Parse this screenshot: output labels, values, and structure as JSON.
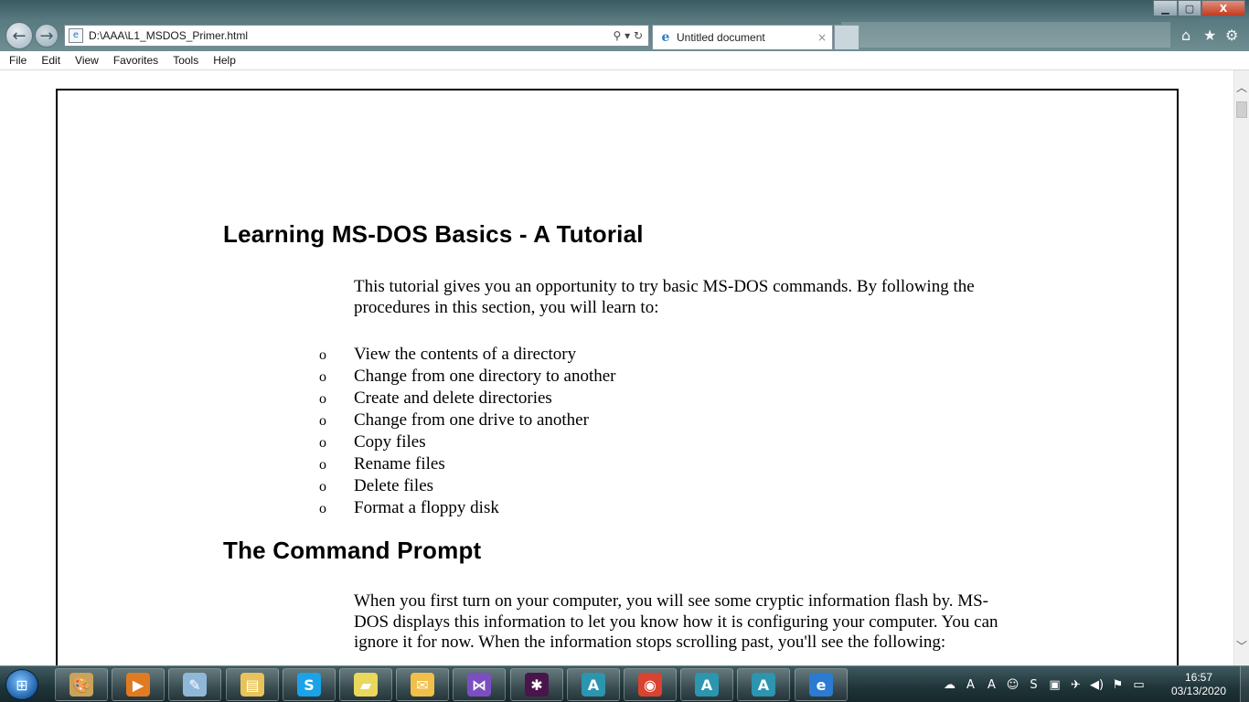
{
  "browser": {
    "address_url": "D:\\AAA\\L1_MSDOS_Primer.html",
    "tab_title": "Untitled document",
    "tab_close": "×",
    "address_controls": "⚲ ▾ ↻",
    "window_buttons": {
      "minimize": "▁",
      "maximize": "▢",
      "close": "X"
    },
    "toolbar_icons": {
      "home": "⌂",
      "favorites": "★",
      "tools": "⚙"
    }
  },
  "menu": {
    "items": [
      "File",
      "Edit",
      "View",
      "Favorites",
      "Tools",
      "Help"
    ]
  },
  "document": {
    "heading1": "Learning MS-DOS Basics - A Tutorial",
    "intro": "This tutorial gives you an opportunity to try basic MS-DOS commands. By following the procedures in this section, you will learn to:",
    "bullet_glyph": "o",
    "bullets": [
      "View the contents of a directory",
      "Change from one directory to another",
      "Create and delete directories",
      "Change from one drive to another",
      "Copy files",
      "Rename files",
      "Delete files",
      "Format a floppy disk"
    ],
    "heading2": "The Command Prompt",
    "para2": "When you first turn on your computer, you will see some cryptic information flash by. MS-DOS displays this information to let you know how it is configuring your computer. You can ignore it for now. When the information stops scrolling past, you'll see the following:"
  },
  "taskbar": {
    "apps": [
      {
        "name": "paint",
        "glyph": "🎨",
        "color": "#c9a35a"
      },
      {
        "name": "media-player",
        "glyph": "▶",
        "color": "#e07b22"
      },
      {
        "name": "notepad",
        "glyph": "✎",
        "color": "#8fb7d8"
      },
      {
        "name": "explorer",
        "glyph": "▤",
        "color": "#e8c35a"
      },
      {
        "name": "skype",
        "glyph": "S",
        "color": "#1aa3e8"
      },
      {
        "name": "sticky-notes",
        "glyph": "▰",
        "color": "#e9d85b"
      },
      {
        "name": "outlook",
        "glyph": "✉",
        "color": "#f0c04a"
      },
      {
        "name": "visual-studio",
        "glyph": "⋈",
        "color": "#7b4fc1"
      },
      {
        "name": "slack",
        "glyph": "✱",
        "color": "#4a154b"
      },
      {
        "name": "arduino",
        "glyph": "A",
        "color": "#2c95b0"
      },
      {
        "name": "chrome",
        "glyph": "◉",
        "color": "#d9432f"
      },
      {
        "name": "arduino-2",
        "glyph": "A",
        "color": "#2c95b0"
      },
      {
        "name": "arduino-3",
        "glyph": "A",
        "color": "#2c95b0"
      },
      {
        "name": "internet-explorer",
        "glyph": "e",
        "color": "#2a7bd1"
      }
    ],
    "tray_icons": [
      "☁",
      "A",
      "A",
      "☺",
      "S",
      "▣",
      "✈",
      "◀)",
      "⚑",
      "▭"
    ],
    "time": "16:57",
    "date": "03/13/2020"
  }
}
